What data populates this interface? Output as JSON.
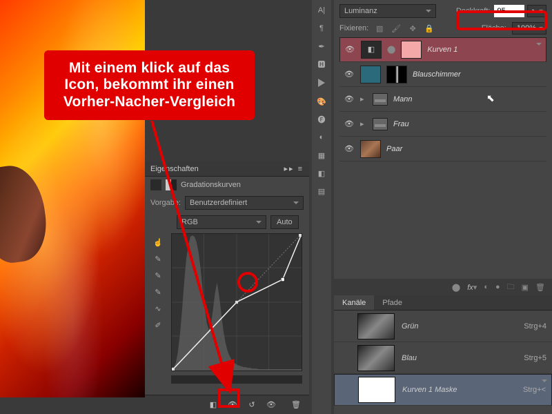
{
  "annotation": {
    "text": "Mit einem klick auf das Icon, bekommt ihr einen Vorher-Nacher-Vergleich"
  },
  "properties": {
    "title": "Eigenschaften",
    "subtitle": "Gradationskurven",
    "preset_label": "Vorgabe:",
    "preset_value": "Benutzerdefiniert",
    "channel_value": "RGB",
    "auto_label": "Auto"
  },
  "layers_panel": {
    "blend_mode": "Luminanz",
    "opacity_label": "Deckkraft:",
    "opacity_value": "95",
    "lock_label": "Fixieren:",
    "fill_label": "Fläche:",
    "fill_value": "100%",
    "layers": [
      {
        "name": "Kurven 1",
        "selected": true,
        "type": "adjust"
      },
      {
        "name": "Blauschimmer",
        "selected": false,
        "type": "mask"
      },
      {
        "name": "Mann",
        "selected": false,
        "type": "folder"
      },
      {
        "name": "Frau",
        "selected": false,
        "type": "folder"
      },
      {
        "name": "Paar",
        "selected": false,
        "type": "photo"
      }
    ]
  },
  "channels_panel": {
    "tab1": "Kanäle",
    "tab2": "Pfade",
    "channels": [
      {
        "name": "Grün",
        "key": "Strg+4"
      },
      {
        "name": "Blau",
        "key": "Strg+5"
      },
      {
        "name": "Kurven 1 Maske",
        "key": "Strg+<",
        "selected": true,
        "white": true
      }
    ]
  },
  "chart_data": {
    "type": "line",
    "title": "Gradationskurven",
    "xlabel": "",
    "ylabel": "",
    "xlim": [
      0,
      255
    ],
    "ylim": [
      0,
      255
    ],
    "series": [
      {
        "name": "curve",
        "x": [
          0,
          128,
          218,
          255
        ],
        "y": [
          0,
          128,
          170,
          255
        ]
      }
    ],
    "histogram": [
      2,
      5,
      12,
      28,
      55,
      90,
      130,
      165,
      185,
      198,
      200,
      198,
      190,
      175,
      150,
      120,
      92,
      70,
      60,
      68,
      90,
      115,
      130,
      110,
      85,
      60,
      42,
      30,
      22,
      16,
      12,
      10,
      8,
      7,
      6,
      5,
      5,
      4,
      4,
      3,
      3,
      3,
      2,
      2,
      2,
      2,
      2,
      2,
      2,
      2,
      2,
      2,
      2,
      2,
      2,
      2,
      2,
      2,
      2,
      2,
      2,
      2,
      2,
      2
    ]
  }
}
